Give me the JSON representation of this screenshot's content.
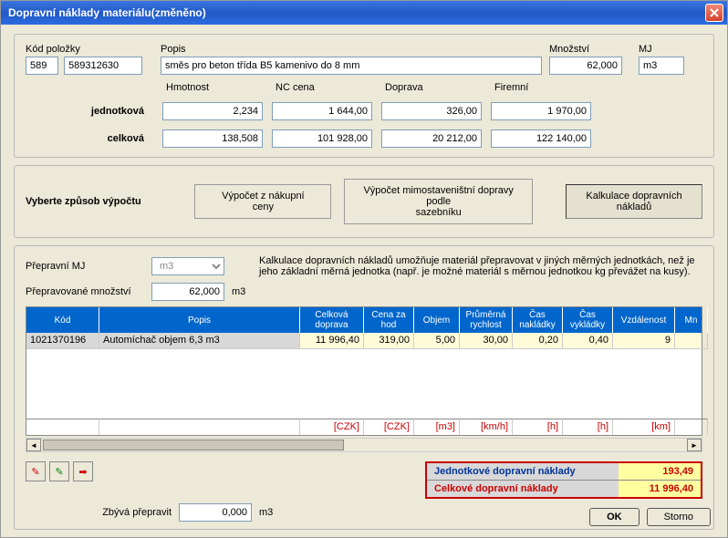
{
  "window": {
    "title": "Dopravní náklady materiálu(změněno)"
  },
  "top": {
    "kod_label": "Kód položky",
    "kod1": "589",
    "kod2": "589312630",
    "popis_label": "Popis",
    "popis": "směs pro beton třída B5 kamenivo do 8 mm",
    "mnozstvi_label": "Množství",
    "mnozstvi": "62,000",
    "mj_label": "MJ",
    "mj": "m3",
    "hmotnost_label": "Hmotnost",
    "nc_label": "NC cena",
    "doprava_label": "Doprava",
    "firemni_label": "Firemní",
    "jednotkova_label": "jednotková",
    "celkova_label": "celková",
    "j_hmotnost": "2,234",
    "j_nc": "1 644,00",
    "j_doprava": "326,00",
    "j_firemni": "1 970,00",
    "c_hmotnost": "138,508",
    "c_nc": "101 928,00",
    "c_doprava": "20 212,00",
    "c_firemni": "122 140,00"
  },
  "mode": {
    "label": "Vyberte způsob výpočtu",
    "btn1": "Výpočet z nákupní\nceny",
    "btn2": "Výpočet mimostaveništní dopravy podle\nsazebníku",
    "btn3": "Kalkulace dopravních\nnákladů"
  },
  "transport": {
    "mj_label": "Přepravní MJ",
    "mj": "m3",
    "mnozstvi_label": "Přepravované množství",
    "mnozstvi": "62,000",
    "mnozstvi_unit": "m3",
    "hint": "Kalkulace dopravních nákladů umožňuje materiál přepravovat v jiných měrných jednotkách, než je jeho základní měrná jednotka (např. je možné materiál s měrnou jednotkou kg převážet na kusy)."
  },
  "grid": {
    "headers": [
      "Kód",
      "Popis",
      "Celková doprava",
      "Cena za hod",
      "Objem",
      "Průměrná rychlost",
      "Čas nakládky",
      "Čas vykládky",
      "Vzdálenost",
      "Mn"
    ],
    "row": {
      "kod": "1021370196",
      "popis": "Automíchač objem 6,3 m3",
      "celkova": "11 996,40",
      "cena": "319,00",
      "objem": "5,00",
      "rychlost": "30,00",
      "nakladky": "0,20",
      "vykladky": "0,40",
      "vzdalenost": "9",
      "mn": ""
    },
    "footer": [
      "[CZK]",
      "[CZK]",
      "[m3]",
      "[km/h]",
      "[h]",
      "[h]",
      "[km]"
    ]
  },
  "bottom": {
    "zbyva_label": "Zbývá přepravit",
    "zbyva": "0,000",
    "zbyva_unit": "m3",
    "sum1_label": "Jednotkové dopravní náklady",
    "sum1_val": "193,49",
    "sum2_label": "Celkové dopravní náklady",
    "sum2_val": "11 996,40"
  },
  "buttons": {
    "ok": "OK",
    "cancel": "Storno"
  }
}
